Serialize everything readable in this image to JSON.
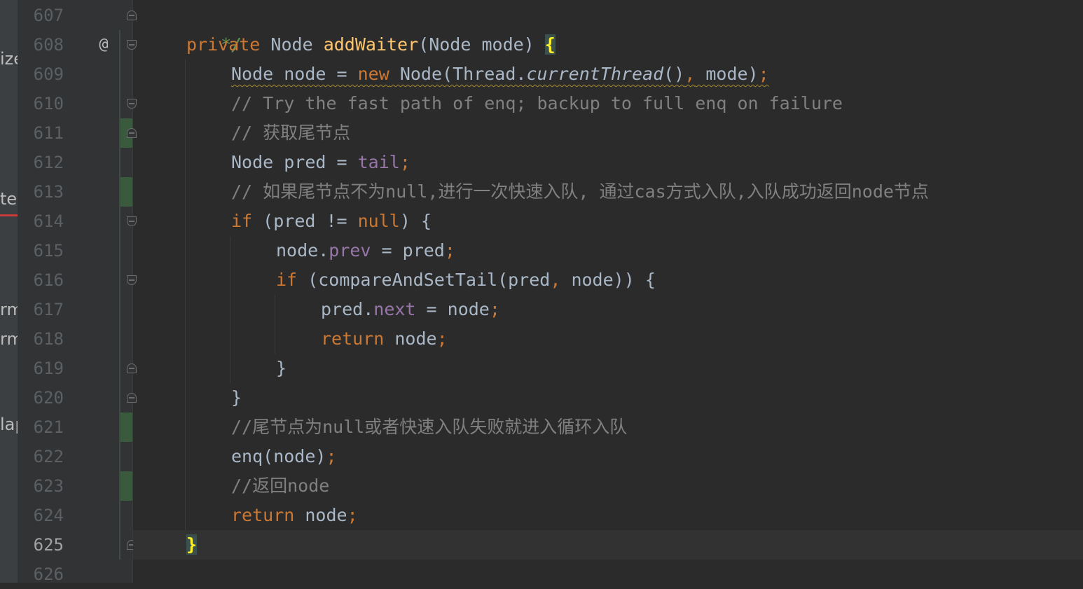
{
  "left_strip": {
    "fragments": [
      "ize",
      "te",
      "rm",
      "rm",
      "lap"
    ]
  },
  "gutter": {
    "override_marker": "@",
    "line_numbers": [
      "607",
      "608",
      "609",
      "610",
      "611",
      "612",
      "613",
      "614",
      "615",
      "616",
      "617",
      "618",
      "619",
      "620",
      "621",
      "622",
      "623",
      "624",
      "625",
      "626"
    ],
    "current_line": "625"
  },
  "code": {
    "l607": {
      "doc": " */"
    },
    "l608": {
      "kw_private": "private ",
      "type_node": "Node ",
      "method": "addWaiter",
      "params": "(Node mode) ",
      "brace": "{"
    },
    "l609": {
      "a": "Node node = ",
      "kw_new": "new",
      "b": " Node(Thread.",
      "static_call": "currentThread",
      "c": "()",
      "comma": ",",
      "d": " mode)",
      "semi": ";"
    },
    "l610": {
      "comment": "// Try the fast path of enq; backup to full enq on failure"
    },
    "l611": {
      "comment": "// 获取尾节点"
    },
    "l612": {
      "a": "Node pred = ",
      "field": "tail",
      "semi": ";"
    },
    "l613": {
      "comment": "// 如果尾节点不为null,进行一次快速入队, 通过cas方式入队,入队成功返回node节点"
    },
    "l614": {
      "kw_if": "if",
      "a": " (pred != ",
      "kw_null": "null",
      "b": ") {"
    },
    "l615": {
      "a": "node.",
      "field": "prev",
      "b": " = pred",
      "semi": ";"
    },
    "l616": {
      "kw_if": "if",
      "a": " (compareAndSetTail(pred",
      "comma": ",",
      "b": " node)) {"
    },
    "l617": {
      "a": "pred.",
      "field": "next",
      "b": " = node",
      "semi": ";"
    },
    "l618": {
      "kw_return": "return",
      "a": " node",
      "semi": ";"
    },
    "l619": {
      "brace": "}"
    },
    "l620": {
      "brace": "}"
    },
    "l621": {
      "comment": "//尾节点为null或者快速入队失败就进入循环入队"
    },
    "l622": {
      "a": "enq(node)",
      "semi": ";"
    },
    "l623": {
      "comment": "//返回node"
    },
    "l624": {
      "kw_return": "return",
      "a": " node",
      "semi": ";"
    },
    "l625": {
      "brace": "}"
    },
    "l626": {}
  },
  "colors": {
    "background": "#2b2b2b",
    "keyword": "#cc7832",
    "method_decl": "#ffc66d",
    "field": "#9876aa",
    "comment": "#808080",
    "doc_comment": "#629755",
    "text": "#a9b7c6"
  }
}
